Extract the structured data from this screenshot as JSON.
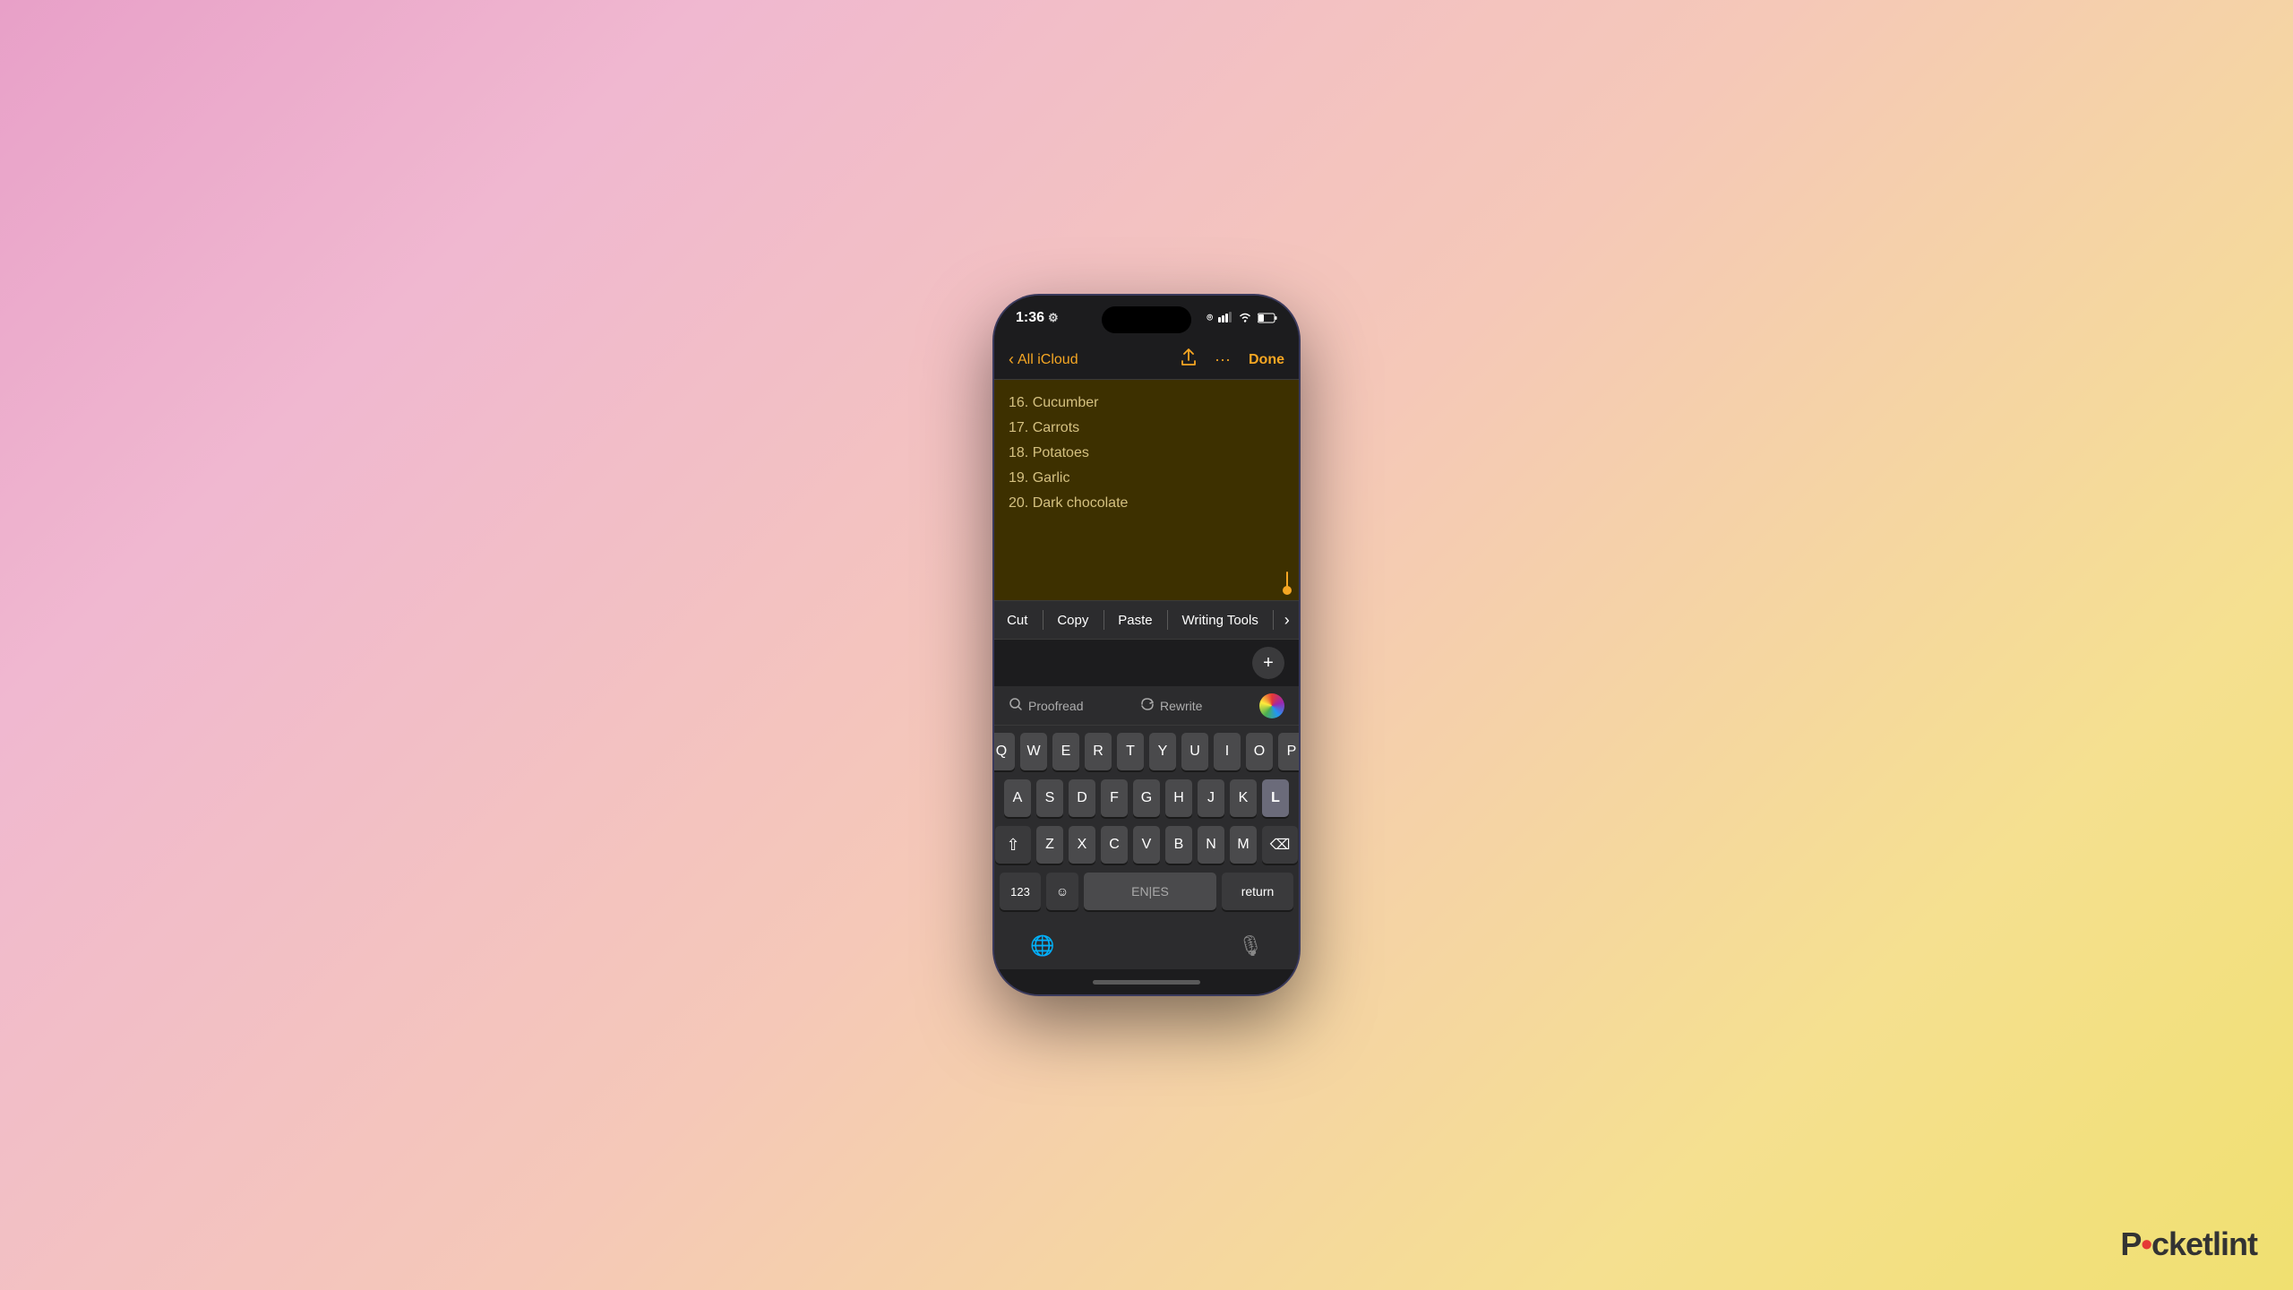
{
  "status_bar": {
    "time": "1:36",
    "gear": "⚙",
    "signal": "▐▐",
    "wifi": "WiFi",
    "battery": "35"
  },
  "nav": {
    "back_label": "All iCloud",
    "done_label": "Done"
  },
  "note": {
    "lines": [
      "16. Cucumber",
      "17. Carrots",
      "18. Potatoes",
      "19. Garlic",
      "20. Dark chocolate"
    ]
  },
  "context_menu": {
    "cut": "Cut",
    "copy": "Copy",
    "paste": "Paste",
    "writing_tools": "Writing Tools"
  },
  "writing_tools": {
    "proofread": "Proofread",
    "rewrite": "Rewrite"
  },
  "keyboard": {
    "row1": [
      "Q",
      "W",
      "E",
      "R",
      "T",
      "Y",
      "U",
      "I",
      "O",
      "P"
    ],
    "row2": [
      "A",
      "S",
      "D",
      "F",
      "G",
      "H",
      "J",
      "K",
      "L"
    ],
    "row3": [
      "Z",
      "X",
      "C",
      "V",
      "B",
      "N",
      "M"
    ],
    "space_label": "EN|ES",
    "return_label": "return",
    "numbers_label": "123"
  },
  "bottom": {
    "globe": "🌐",
    "mic": "🎙"
  },
  "pocketlint": {
    "text": "Pocketlint",
    "dot_color": "#e53935"
  }
}
